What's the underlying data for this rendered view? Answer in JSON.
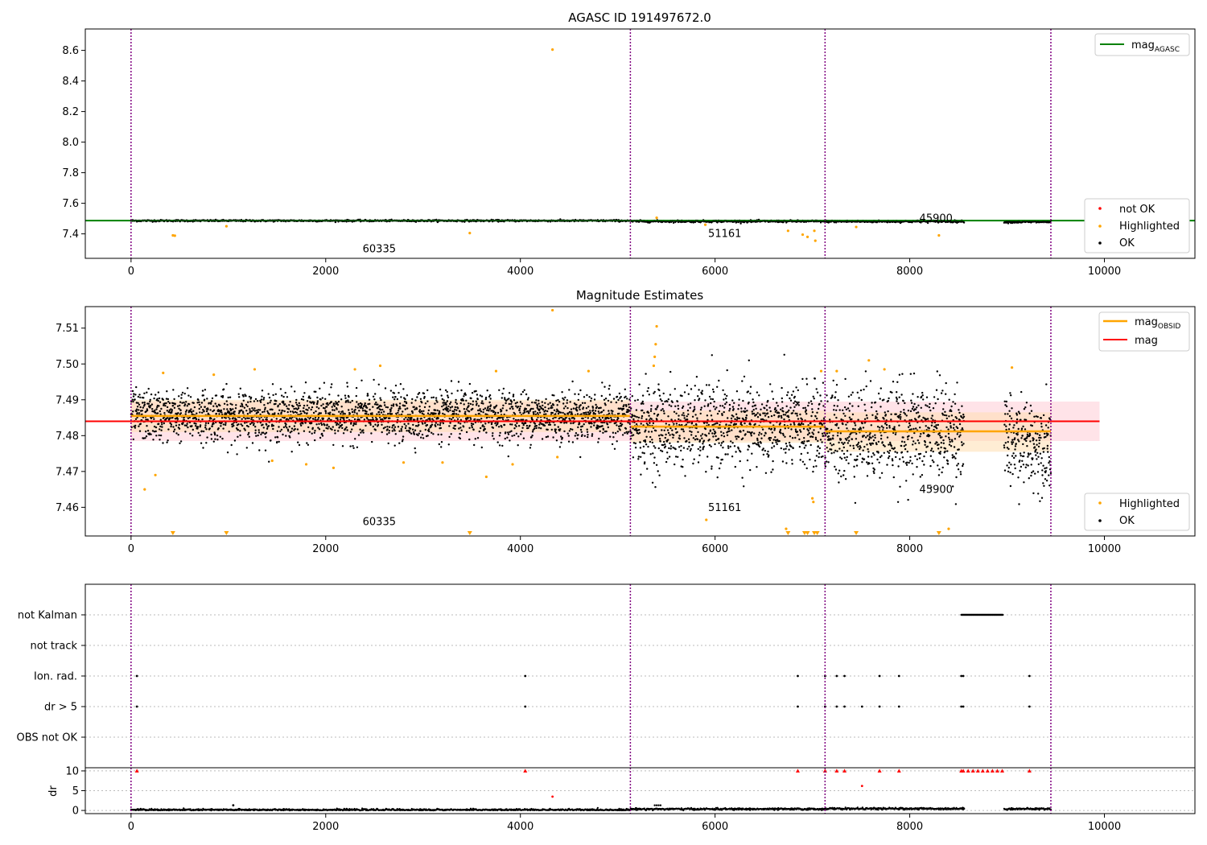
{
  "chart_data": [
    {
      "type": "scatter",
      "title": "AGASC ID 191497672.0",
      "xlim": [
        -470,
        10930
      ],
      "ylim": [
        7.24,
        8.74
      ],
      "xticks": [
        "0",
        "2000",
        "4000",
        "6000",
        "8000",
        "10000"
      ],
      "yticks": [
        "7.4",
        "7.6",
        "7.8",
        "8.0",
        "8.2",
        "8.4",
        "8.6"
      ],
      "obsid_boundaries": [
        0,
        5130,
        7130,
        9450
      ],
      "annotations": [
        {
          "text": "60335",
          "x": 2550,
          "y": 7.28
        },
        {
          "text": "51161",
          "x": 6100,
          "y": 7.38
        },
        {
          "text": "45900",
          "x": 8270,
          "y": 7.48
        }
      ],
      "mag_agasc": 7.487,
      "ok_bands": [
        {
          "x0": 0,
          "x1": 5130,
          "y": 7.486,
          "spread": 0.008
        },
        {
          "x0": 5130,
          "x1": 7130,
          "y": 7.482,
          "spread": 0.01
        },
        {
          "x0": 7130,
          "x1": 8560,
          "y": 7.481,
          "spread": 0.01
        },
        {
          "x0": 8970,
          "x1": 9450,
          "y": 7.478,
          "spread": 0.01
        }
      ],
      "highlighted": [
        {
          "x": 430,
          "y": 7.39
        },
        {
          "x": 450,
          "y": 7.388
        },
        {
          "x": 980,
          "y": 7.45
        },
        {
          "x": 3480,
          "y": 7.405
        },
        {
          "x": 4330,
          "y": 8.605
        },
        {
          "x": 5400,
          "y": 7.505
        },
        {
          "x": 5900,
          "y": 7.46
        },
        {
          "x": 6750,
          "y": 7.42
        },
        {
          "x": 6900,
          "y": 7.395
        },
        {
          "x": 6950,
          "y": 7.38
        },
        {
          "x": 7020,
          "y": 7.42
        },
        {
          "x": 7030,
          "y": 7.355
        },
        {
          "x": 7450,
          "y": 7.445
        },
        {
          "x": 8300,
          "y": 7.39
        }
      ],
      "legend_upper": [
        "mag_AGASC"
      ],
      "legend_lower": [
        "not OK",
        "Highlighted",
        "OK"
      ],
      "colors": {
        "ok": "#000000",
        "highlighted": "#ffa500",
        "not_ok": "#ff0000",
        "agasc_line": "#008000",
        "obsid_line": "#800080"
      }
    },
    {
      "type": "scatter",
      "title": "Magnitude Estimates",
      "xlim": [
        -470,
        10930
      ],
      "ylim": [
        7.452,
        7.516
      ],
      "xticks": [
        "0",
        "2000",
        "4000",
        "6000",
        "8000",
        "10000"
      ],
      "yticks": [
        "7.46",
        "7.47",
        "7.48",
        "7.49",
        "7.50",
        "7.51"
      ],
      "mag": 7.484,
      "mag_band": [
        7.4785,
        7.4895
      ],
      "mag_obsid": [
        {
          "x0": 0,
          "x1": 5130,
          "y": 7.4855,
          "band": [
            7.481,
            7.49
          ]
        },
        {
          "x0": 5130,
          "x1": 7130,
          "y": 7.4825,
          "band": [
            7.478,
            7.487
          ]
        },
        {
          "x0": 7130,
          "x1": 9450,
          "y": 7.4812,
          "band": [
            7.4755,
            7.4865
          ]
        }
      ],
      "annotations": [
        {
          "text": "60335",
          "x": 2550,
          "y": 7.455
        },
        {
          "text": "51161",
          "x": 6100,
          "y": 7.459
        },
        {
          "text": "45900",
          "x": 8270,
          "y": 7.464
        }
      ],
      "highlighted": [
        {
          "x": 140,
          "y": 7.465
        },
        {
          "x": 250,
          "y": 7.469
        },
        {
          "x": 330,
          "y": 7.4975
        },
        {
          "x": 850,
          "y": 7.497
        },
        {
          "x": 1270,
          "y": 7.4985
        },
        {
          "x": 1450,
          "y": 7.473
        },
        {
          "x": 1800,
          "y": 7.472
        },
        {
          "x": 2080,
          "y": 7.471
        },
        {
          "x": 2300,
          "y": 7.4985
        },
        {
          "x": 2560,
          "y": 7.4995
        },
        {
          "x": 2800,
          "y": 7.4725
        },
        {
          "x": 3200,
          "y": 7.4725
        },
        {
          "x": 3650,
          "y": 7.4685
        },
        {
          "x": 3750,
          "y": 7.498
        },
        {
          "x": 3920,
          "y": 7.472
        },
        {
          "x": 4330,
          "y": 7.515
        },
        {
          "x": 4380,
          "y": 7.474
        },
        {
          "x": 4700,
          "y": 7.498
        },
        {
          "x": 5400,
          "y": 7.5105
        },
        {
          "x": 5390,
          "y": 7.5055
        },
        {
          "x": 5380,
          "y": 7.502
        },
        {
          "x": 5370,
          "y": 7.4995
        },
        {
          "x": 5910,
          "y": 7.4565
        },
        {
          "x": 6730,
          "y": 7.454
        },
        {
          "x": 7000,
          "y": 7.4625
        },
        {
          "x": 7010,
          "y": 7.4615
        },
        {
          "x": 7090,
          "y": 7.498
        },
        {
          "x": 7250,
          "y": 7.498
        },
        {
          "x": 7580,
          "y": 7.501
        },
        {
          "x": 7740,
          "y": 7.4985
        },
        {
          "x": 8400,
          "y": 7.454
        },
        {
          "x": 9050,
          "y": 7.499
        }
      ],
      "clipped_markers_x": [
        430,
        980,
        3480,
        6750,
        6920,
        6950,
        7020,
        7050,
        7450,
        8300
      ],
      "legend_upper": [
        "mag_OBSID",
        "mag"
      ],
      "legend_lower": [
        "Highlighted",
        "OK"
      ],
      "colors": {
        "mag": "#ff0000",
        "mag_obsid": "#ffa500",
        "band": "#ffc0cb",
        "obsid_band": "#ffdfb0"
      }
    },
    {
      "type": "scatter",
      "xlim": [
        -470,
        10930
      ],
      "categories": [
        "not Kalman",
        "not track",
        "Ion. rad.",
        "dr > 5",
        "OBS not OK"
      ],
      "xticks": [
        "0",
        "2000",
        "4000",
        "6000",
        "8000",
        "10000"
      ],
      "flags": {
        "not Kalman": {
          "ranges": [
            [
              8530,
              8960
            ]
          ]
        },
        "not track": {
          "ranges": []
        },
        "Ion. rad.": {
          "points": [
            60,
            4050,
            6850,
            7130,
            7250,
            7330,
            7690,
            7890,
            8530,
            8550,
            9230
          ]
        },
        "dr > 5": {
          "points": [
            60,
            4050,
            6850,
            7130,
            7250,
            7330,
            7510,
            7690,
            7890,
            8530,
            8550,
            9230
          ]
        },
        "OBS not OK": {
          "points": []
        }
      }
    },
    {
      "type": "scatter",
      "ylabel": "dr",
      "xlim": [
        -470,
        10930
      ],
      "ylim": [
        -0.8,
        10.8
      ],
      "xticks": [
        "0",
        "2000",
        "4000",
        "6000",
        "8000",
        "10000"
      ],
      "yticks": [
        "0",
        "5",
        "10"
      ],
      "clipped_at_10_x": [
        60,
        4050,
        6850,
        7130,
        7250,
        7330,
        7690,
        7890,
        8530,
        8550,
        8600,
        8650,
        8700,
        8750,
        8800,
        8850,
        8900,
        8950,
        9230
      ],
      "outliers": [
        {
          "x": 4330,
          "y": 3.5
        },
        {
          "x": 7510,
          "y": 6.2
        },
        {
          "x": 1050,
          "y": 1.3
        }
      ],
      "bands": [
        {
          "x0": 0,
          "x1": 5130,
          "y": 0.15
        },
        {
          "x0": 5130,
          "x1": 7130,
          "y": 0.35
        },
        {
          "x0": 7130,
          "x1": 8560,
          "y": 0.45
        },
        {
          "x0": 8970,
          "x1": 9450,
          "y": 0.4
        }
      ]
    }
  ]
}
